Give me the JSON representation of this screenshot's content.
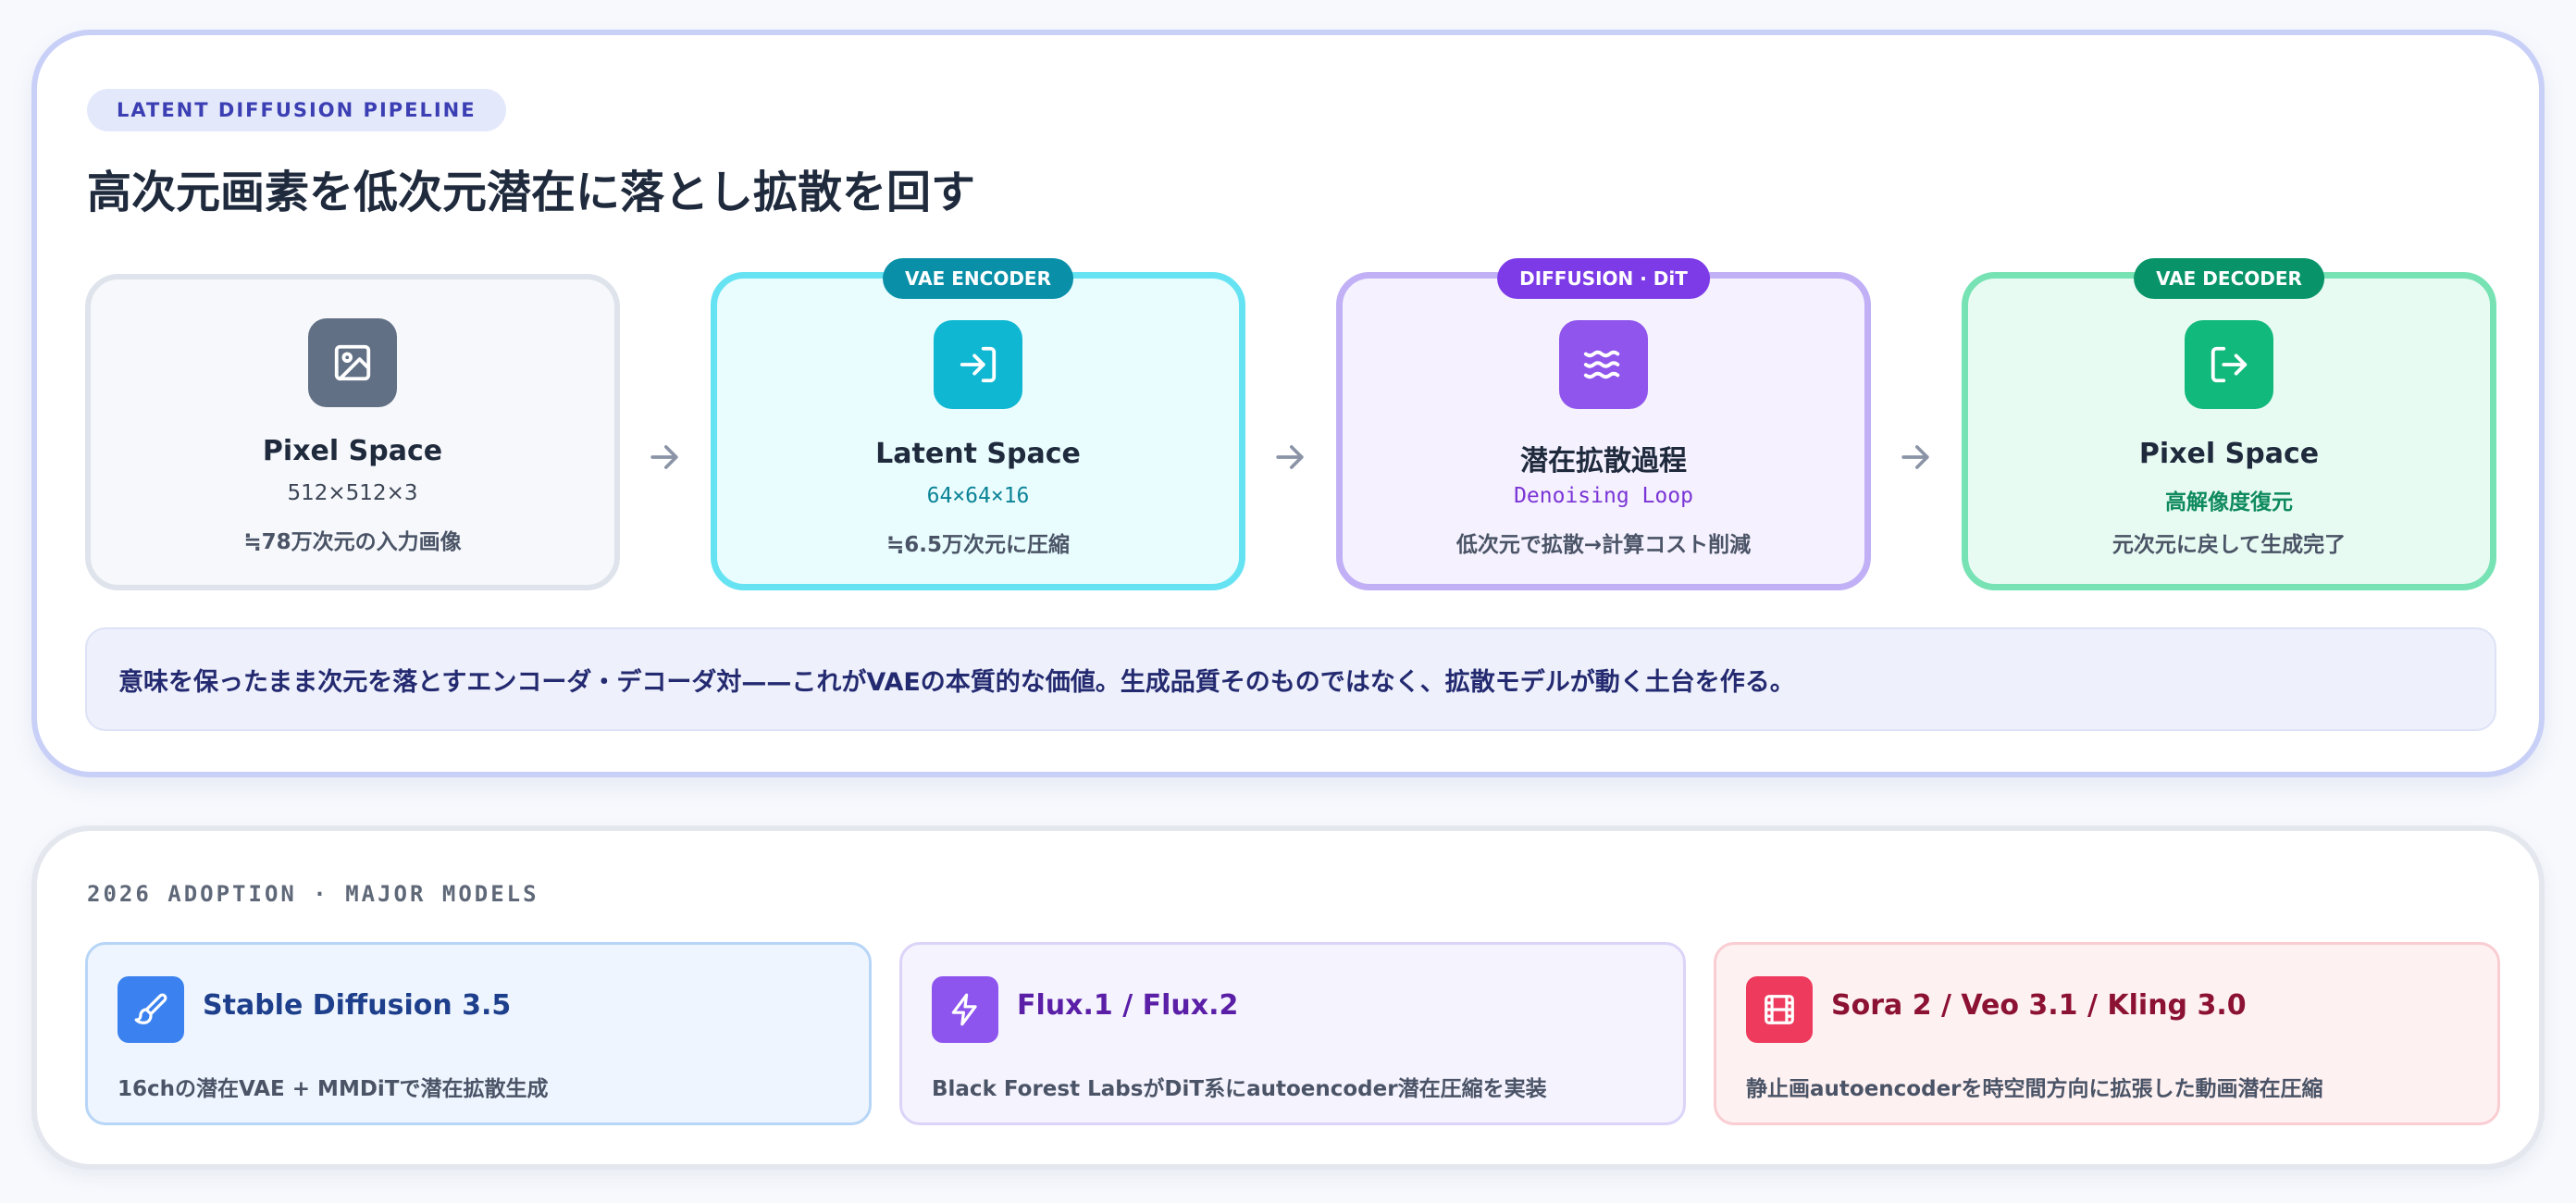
{
  "pipeline": {
    "tag": "LATENT DIFFUSION PIPELINE",
    "title": "高次元画素を低次元潜在に落とし拡散を回す",
    "stages": [
      {
        "badge": "",
        "name": "Pixel Space",
        "dim": "512×512×3",
        "desc": "≒78万次元の入力画像",
        "icon": "image-icon"
      },
      {
        "badge": "VAE ENCODER",
        "name": "Latent Space",
        "dim": "64×64×16",
        "desc": "≒6.5万次元に圧縮",
        "icon": "log-in-icon"
      },
      {
        "badge": "DIFFUSION · DiT",
        "name": "潜在拡散過程",
        "dim": "Denoising Loop",
        "desc": "低次元で拡散→計算コスト削減",
        "icon": "waves-icon"
      },
      {
        "badge": "VAE DECODER",
        "name": "Pixel Space",
        "dim": "高解像度復元",
        "desc": "元次元に戻して生成完了",
        "icon": "log-out-icon"
      }
    ],
    "summary": "意味を保ったまま次元を落とすエンコーダ・デコーダ対——これがVAEの本質的な価値。生成品質そのものではなく、拡散モデルが動く土台を作る。"
  },
  "adoption": {
    "heading": "2026 ADOPTION · MAJOR MODELS",
    "models": [
      {
        "name": "Stable Diffusion 3.5",
        "desc": "16chの潜在VAE + MMDiTで潜在拡散生成",
        "icon": "paintbrush-icon",
        "color": "#3b82f0"
      },
      {
        "name": "Flux.1 / Flux.2",
        "desc": "Black Forest LabsがDiT系にautoencoder潜在圧縮を実装",
        "icon": "lightning-icon",
        "color": "#8d55ee"
      },
      {
        "name": "Sora 2 / Veo 3.1 / Kling 3.0",
        "desc": "静止画autoencoderを時空間方向に拡張した動画潜在圧縮",
        "icon": "film-icon",
        "color": "#ee3a5c"
      }
    ]
  },
  "colors": {
    "accent_indigo": "#3b3fb3",
    "encoder": "#0a8fa8",
    "diffusion": "#7c3be6",
    "decoder": "#089468"
  }
}
